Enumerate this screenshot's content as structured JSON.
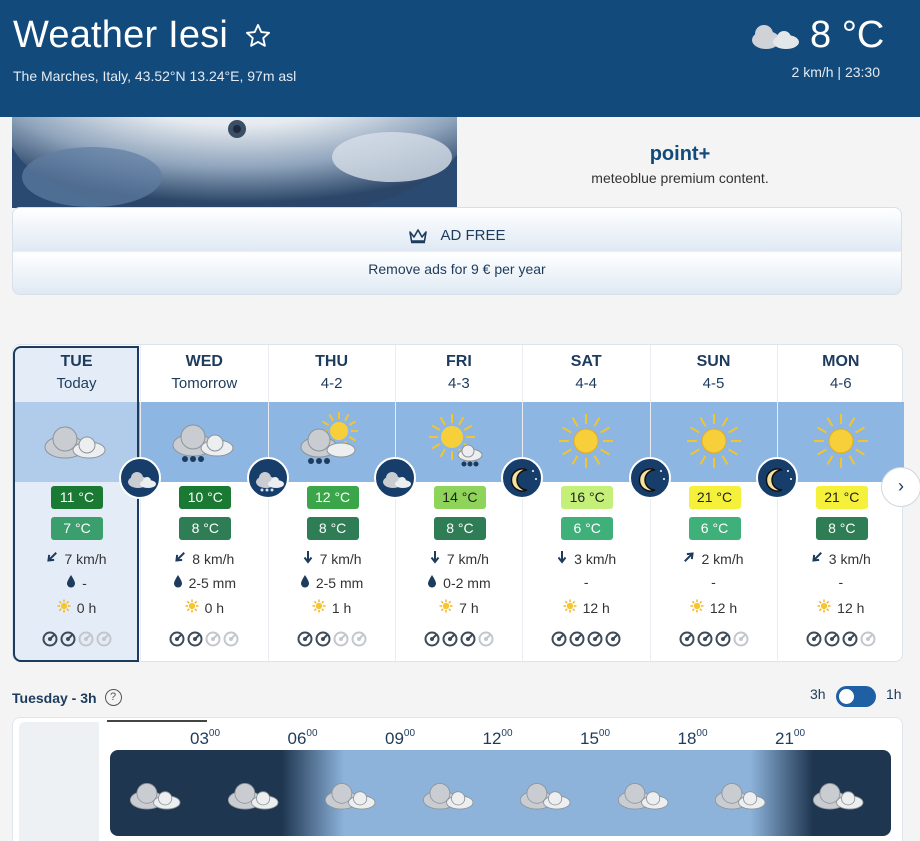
{
  "header": {
    "city": "Weather Iesi",
    "location": "The Marches, Italy, 43.52°N 13.24°E, 97m asl",
    "current_temp": "8 °C",
    "current_meta": "2 km/h  | 23:30"
  },
  "promo": {
    "title": "point+",
    "subtitle": "meteoblue premium content.",
    "adfree_label": "AD FREE",
    "adfree_sub": "Remove ads for 9 € per year"
  },
  "days": [
    {
      "name": "TUE",
      "date": "Today",
      "max": "11 °C",
      "min": "7 °C",
      "wind": "7 km/h",
      "precip": "-",
      "sun": "0 h",
      "max_color": "#1a7a34",
      "min_color": "#3a9f6d",
      "predictability": 2
    },
    {
      "name": "WED",
      "date": "Tomorrow",
      "max": "10 °C",
      "min": "8 °C",
      "wind": "8 km/h",
      "precip": "2-5 mm",
      "sun": "0 h",
      "max_color": "#1a7a34",
      "min_color": "#2f7d55",
      "predictability": 2
    },
    {
      "name": "THU",
      "date": "4-2",
      "max": "12 °C",
      "min": "8 °C",
      "wind": "7 km/h",
      "precip": "2-5 mm",
      "sun": "1 h",
      "max_color": "#3aa549",
      "min_color": "#2f7d55",
      "predictability": 2
    },
    {
      "name": "FRI",
      "date": "4-3",
      "max": "14 °C",
      "min": "8 °C",
      "wind": "7 km/h",
      "precip": "0-2 mm",
      "sun": "7 h",
      "max_color": "#8fd45a",
      "min_color": "#2f7d55",
      "predictability": 3
    },
    {
      "name": "SAT",
      "date": "4-4",
      "max": "16 °C",
      "min": "6 °C",
      "wind": "3 km/h",
      "precip": "-",
      "sun": "12 h",
      "max_color": "#c4f07a",
      "min_color": "#3fb07a",
      "predictability": 4
    },
    {
      "name": "SUN",
      "date": "4-5",
      "max": "21 °C",
      "min": "6 °C",
      "wind": "2 km/h",
      "precip": "-",
      "sun": "12 h",
      "max_color": "#f5f03a",
      "min_color": "#3fb07a",
      "predictability": 3
    },
    {
      "name": "MON",
      "date": "4-6",
      "max": "21 °C",
      "min": "8 °C",
      "wind": "3 km/h",
      "precip": "-",
      "sun": "12 h",
      "max_color": "#f5f03a",
      "min_color": "#2f7d55",
      "predictability": 3
    }
  ],
  "hourly": {
    "title": "Tuesday - 3h",
    "toggle_left": "3h",
    "toggle_right": "1h",
    "times": [
      {
        "h": "03",
        "m": "00"
      },
      {
        "h": "06",
        "m": "00"
      },
      {
        "h": "09",
        "m": "00"
      },
      {
        "h": "12",
        "m": "00"
      },
      {
        "h": "15",
        "m": "00"
      },
      {
        "h": "18",
        "m": "00"
      },
      {
        "h": "21",
        "m": "00"
      }
    ]
  },
  "nav": {
    "next_label": "›"
  },
  "icons": {
    "favorite": "star-icon",
    "help": "?"
  }
}
